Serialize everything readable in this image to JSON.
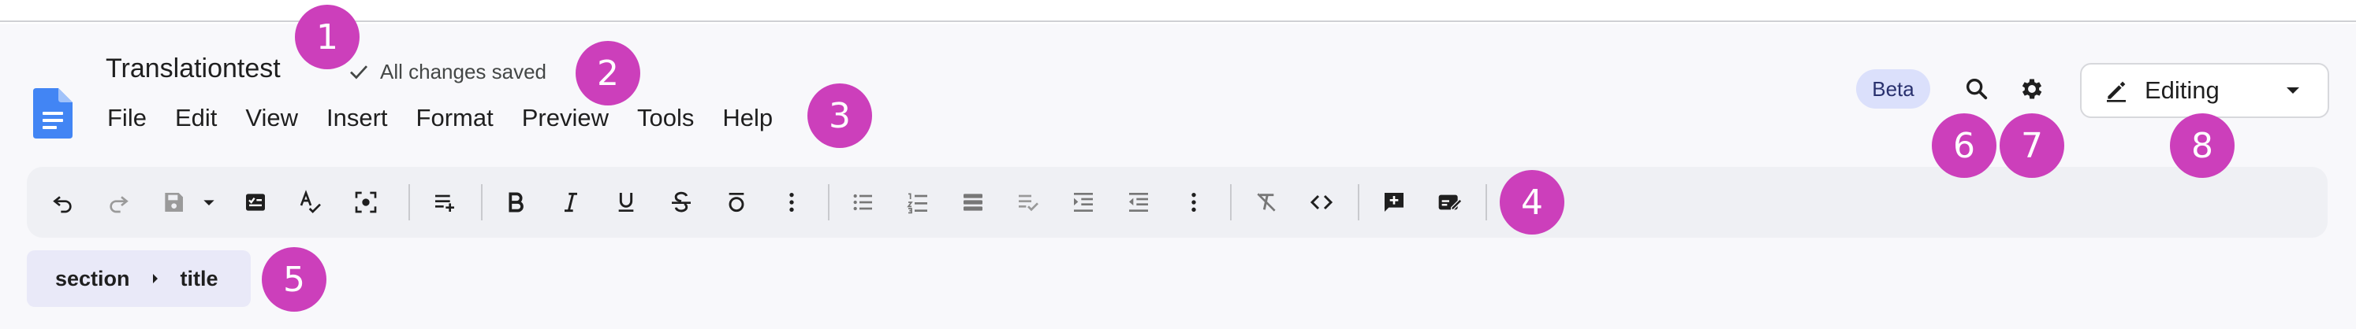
{
  "document": {
    "title": "Translationtest",
    "save_status": "All changes saved",
    "icon": "document-icon"
  },
  "menu": [
    "File",
    "Edit",
    "View",
    "Insert",
    "Format",
    "Preview",
    "Tools",
    "Help"
  ],
  "header_right": {
    "beta_badge": "Beta",
    "search_icon": "search-icon",
    "settings_icon": "gear-icon",
    "mode": "Editing",
    "mode_icon": "pencil-icon"
  },
  "toolbar": {
    "buttons": [
      "undo-icon",
      "redo-icon",
      "save-icon",
      "dropdown-icon",
      "checklist-icon",
      "spellcheck-icon",
      "focus-icon",
      "insert-line-icon",
      "bold-icon",
      "italic-icon",
      "underline-icon",
      "strikethrough-icon",
      "overline-icon",
      "more-icon",
      "bulleted-list-icon",
      "numbered-list-icon",
      "list-icon",
      "checklist-icon",
      "indent-icon",
      "outdent-icon",
      "more-icon",
      "clear-format-icon",
      "code-icon",
      "add-comment-icon",
      "suggest-edit-icon"
    ]
  },
  "breadcrumb": {
    "items": [
      "section",
      "title"
    ]
  },
  "markers": [
    "1",
    "2",
    "3",
    "4",
    "5",
    "6",
    "7",
    "8"
  ],
  "colors": {
    "app_background": "#f8f8fb",
    "toolbar_background": "#eff0f4",
    "breadcrumb_background": "#e9e9f8",
    "beta_badge": "#dbe0fb",
    "marker": "#cc3fbb",
    "doc_icon": "#4285f4"
  }
}
